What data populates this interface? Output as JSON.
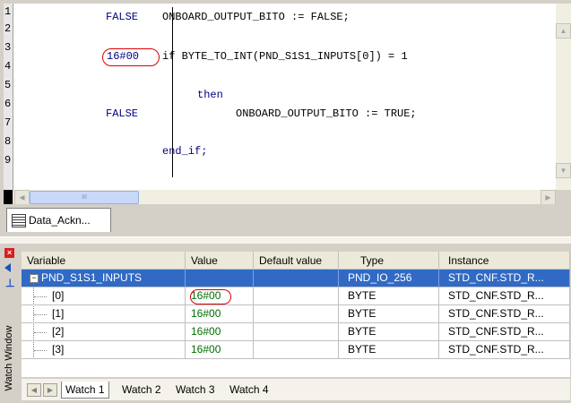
{
  "editor": {
    "line_numbers": [
      "1",
      "2",
      "3",
      "4",
      "5",
      "6",
      "7",
      "8",
      "9"
    ],
    "lines": [
      {
        "line": "1",
        "value": "FALSE",
        "code": "ONBOARD_OUTPUT_BITO := FALSE;"
      },
      {
        "line": "3",
        "value": "16#00",
        "code": "if BYTE_TO_INT(PND_S1S1_INPUTS[0]) = 1"
      },
      {
        "line": "5",
        "value": "",
        "code": "then"
      },
      {
        "line": "6",
        "value": "FALSE",
        "code": "ONBOARD_OUTPUT_BITO := TRUE;"
      },
      {
        "line": "8",
        "value": "",
        "code": "end_if;"
      }
    ]
  },
  "doc_tab": {
    "label": "Data_Ackn..."
  },
  "watch_window": {
    "title": "Watch Window",
    "columns": [
      "Variable",
      "Value",
      "Default value",
      "Type",
      "Instance"
    ],
    "rows": [
      {
        "variable": "PND_S1S1_INPUTS",
        "value": "",
        "default": "",
        "type": "PND_IO_256",
        "instance": "STD_CNF.STD_R..."
      },
      {
        "variable": "[0]",
        "value": "16#00",
        "default": "",
        "type": "BYTE",
        "instance": "STD_CNF.STD_R..."
      },
      {
        "variable": "[1]",
        "value": "16#00",
        "default": "",
        "type": "BYTE",
        "instance": "STD_CNF.STD_R..."
      },
      {
        "variable": "[2]",
        "value": "16#00",
        "default": "",
        "type": "BYTE",
        "instance": "STD_CNF.STD_R..."
      },
      {
        "variable": "[3]",
        "value": "16#00",
        "default": "",
        "type": "BYTE",
        "instance": "STD_CNF.STD_R..."
      }
    ],
    "tree_toggle": "−",
    "sheet_tabs": [
      "Watch 1",
      "Watch 2",
      "Watch 3",
      "Watch 4"
    ]
  },
  "colors": {
    "highlight": "#316ac5",
    "circle": "#e00000",
    "value_text": "#007000",
    "code_text": "#000080"
  },
  "icons": [
    "scroll-up-icon",
    "scroll-down-icon",
    "scroll-left-icon",
    "scroll-right-icon",
    "table-icon",
    "close-icon",
    "arrow-left-icon",
    "pin-icon",
    "first-sheet-icon",
    "next-sheet-icon"
  ]
}
